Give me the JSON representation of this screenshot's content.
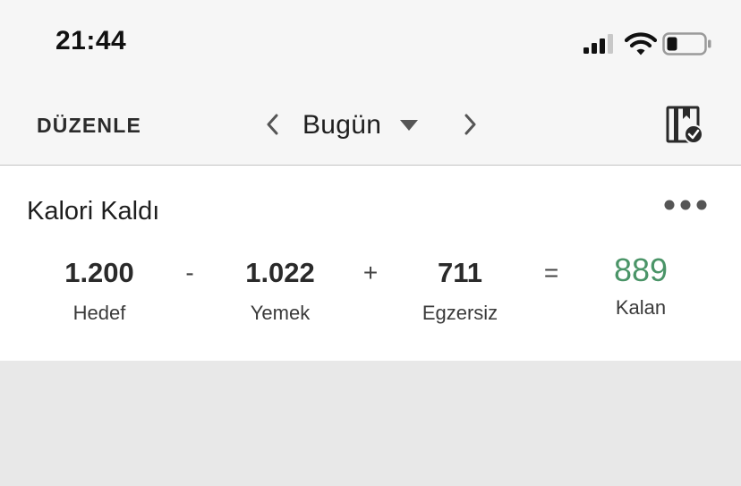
{
  "status_bar": {
    "time": "21:44",
    "signal_icon": "cellular-signal-icon",
    "wifi_icon": "wifi-icon",
    "battery_icon": "battery-low-icon",
    "battery_level": 0.25
  },
  "nav": {
    "edit_label": "DÜZENLE",
    "date_label": "Bugün",
    "prev_icon": "chevron-left-icon",
    "next_icon": "chevron-right-icon",
    "dropdown_icon": "caret-down-icon",
    "complete_icon": "diary-complete-icon"
  },
  "calories_card": {
    "title": "Kalori Kaldı",
    "more_icon": "ellipsis-icon",
    "goal": {
      "value": "1.200",
      "label": "Hedef"
    },
    "food": {
      "value": "1.022",
      "label": "Yemek"
    },
    "exercise": {
      "value": "711",
      "label": "Egzersiz"
    },
    "remaining": {
      "value": "889",
      "label": "Kalan"
    },
    "operators": {
      "minus": "-",
      "plus": "+",
      "equals": "="
    }
  },
  "colors": {
    "remaining_green": "#4a9467",
    "nav_background": "#f6f6f6",
    "page_background": "#e8e8e8",
    "card_background": "#ffffff"
  }
}
